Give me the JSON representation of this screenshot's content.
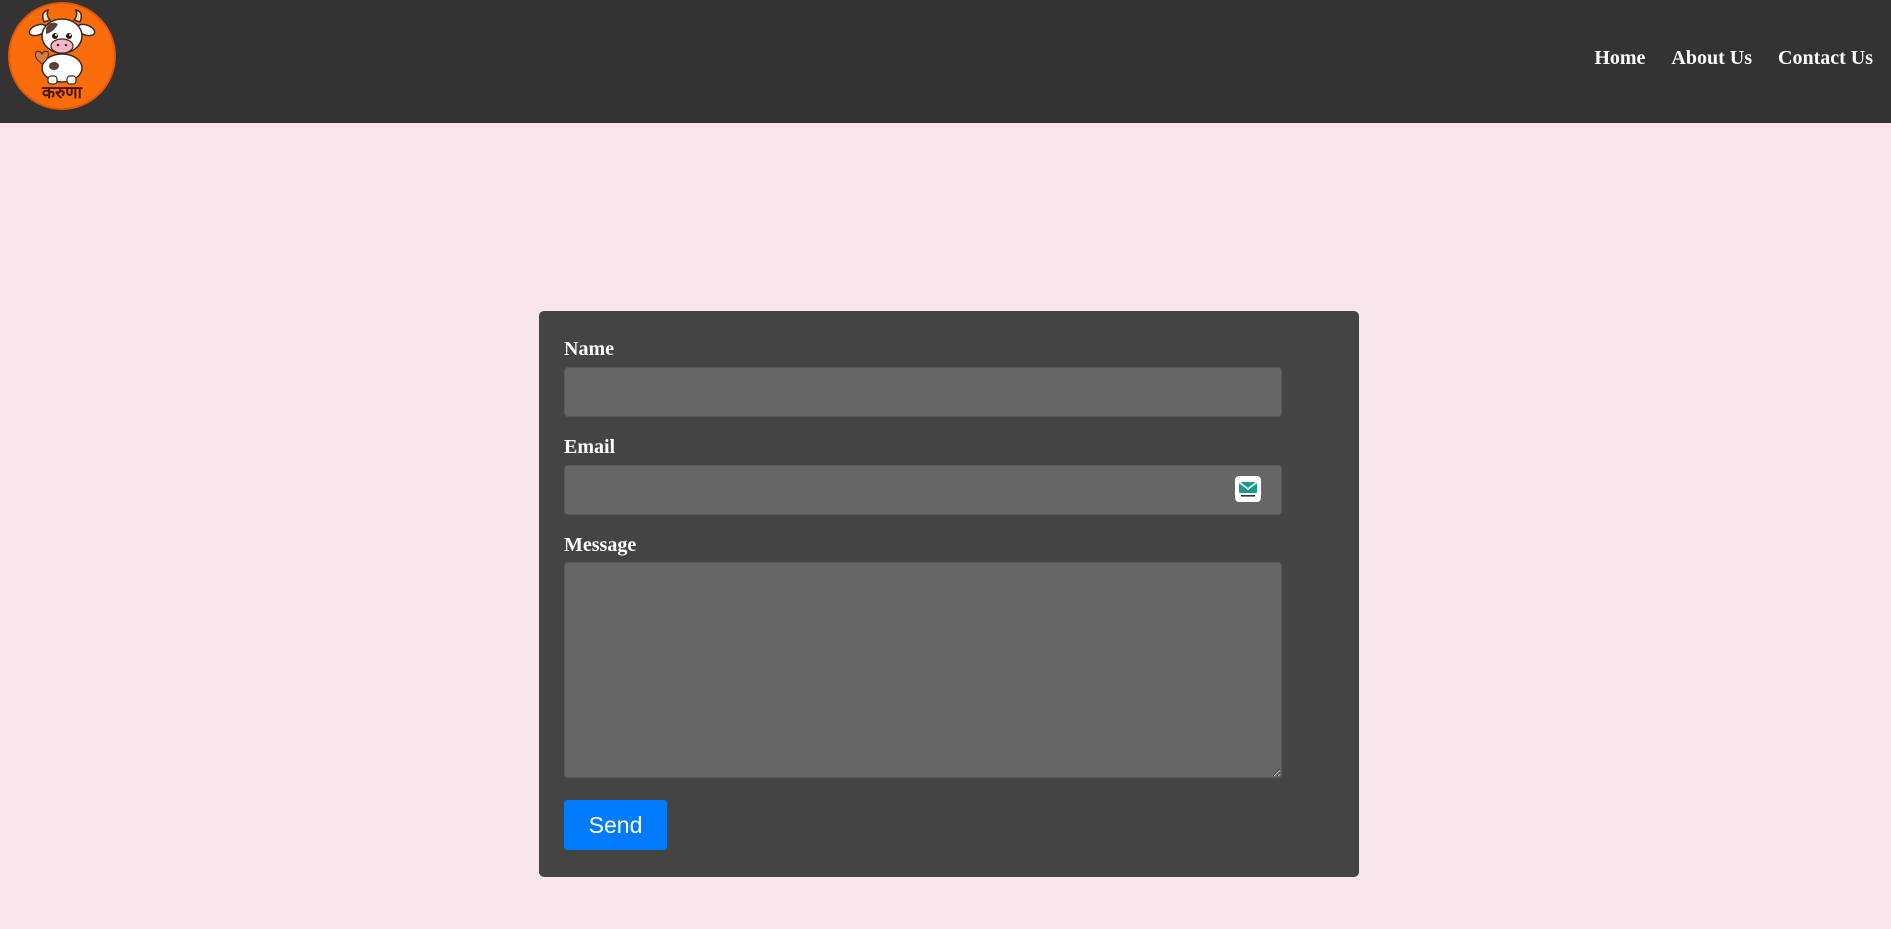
{
  "brand": {
    "logo_icon": "cow-mascot-icon",
    "logo_text": "करुणा",
    "logo_color": "#fb6d0a"
  },
  "nav": {
    "items": [
      {
        "label": "Home"
      },
      {
        "label": "About Us"
      },
      {
        "label": "Contact Us"
      }
    ]
  },
  "form": {
    "name_label": "Name",
    "name_value": "",
    "email_label": "Email",
    "email_value": "",
    "email_icon": "temp-mail-icon",
    "message_label": "Message",
    "message_value": "",
    "send_label": "Send"
  },
  "colors": {
    "header_bg": "#333333",
    "page_bg": "#f8e6ec",
    "card_bg": "#444444",
    "input_bg": "#666666",
    "button_bg": "#007bff"
  }
}
